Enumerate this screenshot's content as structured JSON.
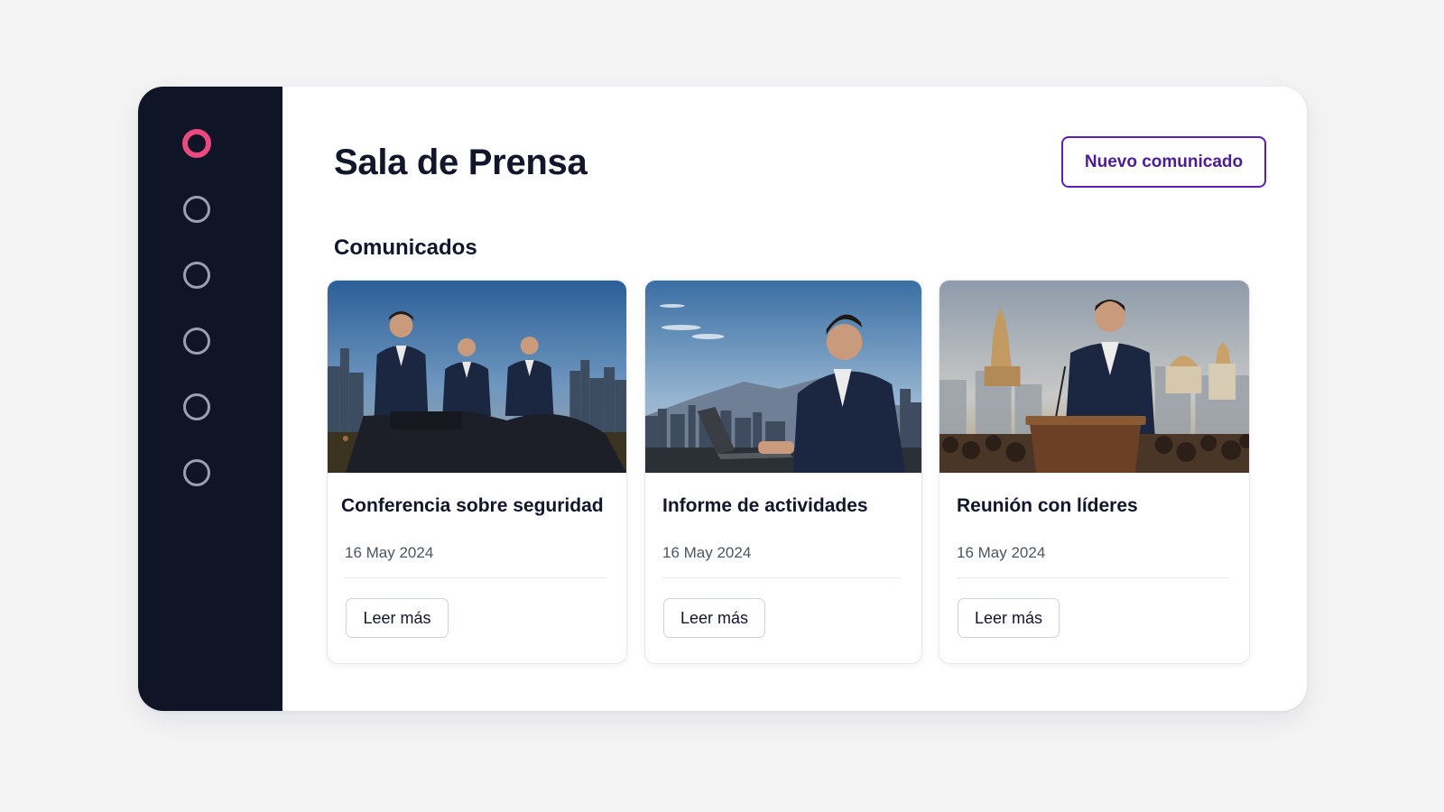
{
  "header": {
    "title": "Sala de Prensa",
    "new_release_label": "Nuevo comunicado"
  },
  "sidebar": {
    "items": [
      {
        "icon": "circle-icon",
        "active": true
      },
      {
        "icon": "circle-icon",
        "active": false
      },
      {
        "icon": "circle-icon",
        "active": false
      },
      {
        "icon": "circle-icon",
        "active": false
      },
      {
        "icon": "circle-icon",
        "active": false
      },
      {
        "icon": "circle-icon",
        "active": false
      }
    ]
  },
  "section": {
    "title": "Comunicados"
  },
  "cards": [
    {
      "title": "Conferencia sobre seguridad",
      "date": "16 May 2024",
      "button": "Leer más"
    },
    {
      "title": "Informe de actividades",
      "date": "16 May 2024",
      "button": "Leer más"
    },
    {
      "title": "Reunión con líderes",
      "date": "16 May 2024",
      "button": "Leer más"
    }
  ],
  "colors": {
    "sidebar_bg": "#0f1427",
    "active_accent": "#ec4a7f",
    "primary_accent": "#5b21b6"
  }
}
